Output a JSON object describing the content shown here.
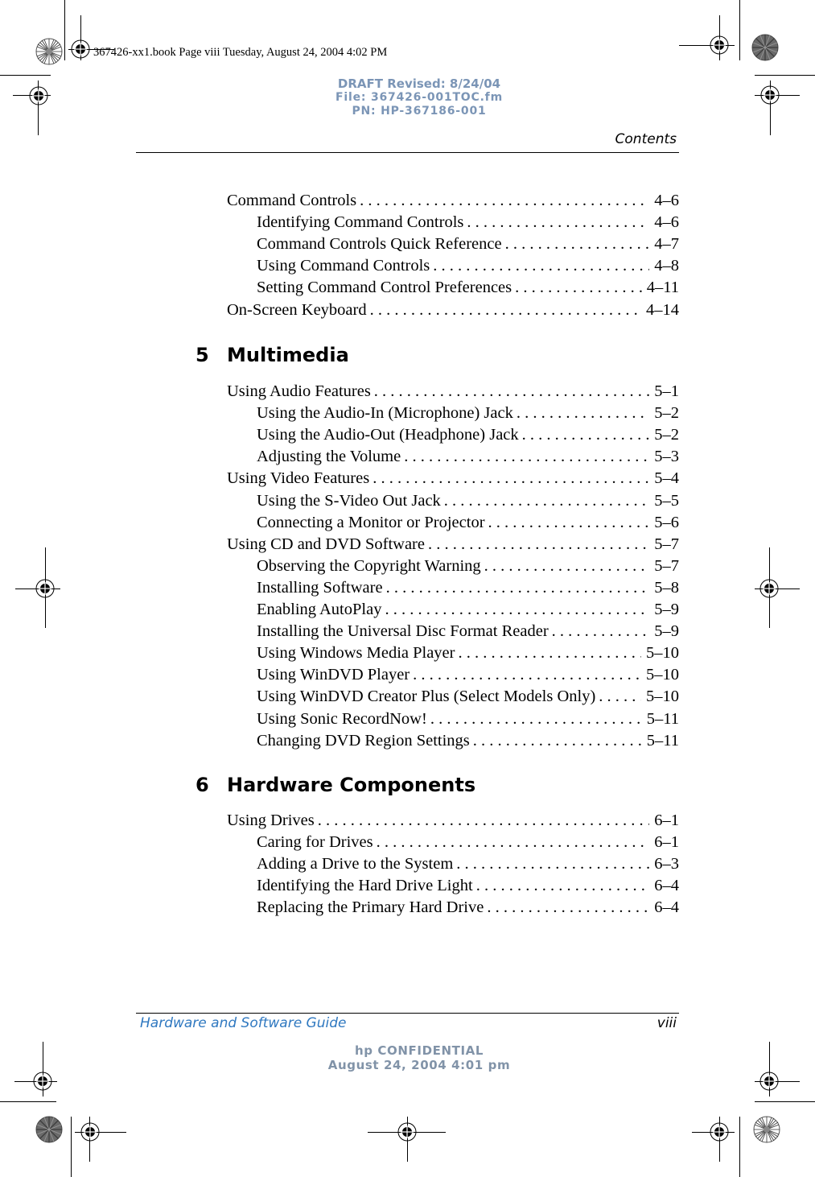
{
  "print_info": {
    "book_line": "367426-xx1.book  Page viii  Tuesday, August 24, 2004  4:02 PM"
  },
  "draft_stamp": {
    "line1": "DRAFT Revised: 8/24/04",
    "line2": "File: 367426-001TOC.fm",
    "line3": "PN: HP-367186-001"
  },
  "header": {
    "running_title": "Contents"
  },
  "toc": {
    "section4_tail": [
      {
        "title": "Command Controls",
        "page": "4–6",
        "level": 1
      },
      {
        "title": "Identifying Command Controls",
        "page": "4–6",
        "level": 2
      },
      {
        "title": "Command Controls Quick Reference",
        "page": "4–7",
        "level": 2
      },
      {
        "title": "Using Command Controls",
        "page": "4–8",
        "level": 2
      },
      {
        "title": "Setting Command Control Preferences",
        "page": "4–11",
        "level": 2
      },
      {
        "title": "On-Screen Keyboard",
        "page": "4–14",
        "level": 1
      }
    ],
    "chapter5": {
      "number": "5",
      "title": "Multimedia",
      "entries": [
        {
          "title": "Using Audio Features",
          "page": "5–1",
          "level": 1
        },
        {
          "title": "Using the Audio-In (Microphone) Jack",
          "page": "5–2",
          "level": 2
        },
        {
          "title": "Using the Audio-Out (Headphone) Jack",
          "page": "5–2",
          "level": 2
        },
        {
          "title": "Adjusting the Volume",
          "page": "5–3",
          "level": 2
        },
        {
          "title": "Using Video Features",
          "page": "5–4",
          "level": 1
        },
        {
          "title": "Using the S-Video Out Jack",
          "page": "5–5",
          "level": 2
        },
        {
          "title": "Connecting a Monitor or Projector",
          "page": "5–6",
          "level": 2
        },
        {
          "title": "Using CD and DVD Software",
          "page": "5–7",
          "level": 1
        },
        {
          "title": "Observing the Copyright Warning",
          "page": "5–7",
          "level": 2
        },
        {
          "title": "Installing Software",
          "page": "5–8",
          "level": 2
        },
        {
          "title": "Enabling AutoPlay",
          "page": "5–9",
          "level": 2
        },
        {
          "title": "Installing the Universal Disc Format Reader",
          "page": "5–9",
          "level": 2
        },
        {
          "title": "Using Windows Media Player",
          "page": "5–10",
          "level": 2
        },
        {
          "title": "Using WinDVD Player",
          "page": "5–10",
          "level": 2
        },
        {
          "title": "Using WinDVD Creator Plus (Select Models Only)",
          "page": "5–10",
          "level": 2
        },
        {
          "title": "Using Sonic RecordNow!",
          "page": "5–11",
          "level": 2
        },
        {
          "title": "Changing DVD Region Settings",
          "page": "5–11",
          "level": 2
        }
      ]
    },
    "chapter6": {
      "number": "6",
      "title": "Hardware Components",
      "entries": [
        {
          "title": "Using Drives",
          "page": "6–1",
          "level": 1
        },
        {
          "title": "Caring for Drives",
          "page": "6–1",
          "level": 2
        },
        {
          "title": "Adding a Drive to the System",
          "page": "6–3",
          "level": 2
        },
        {
          "title": "Identifying the Hard Drive Light",
          "page": "6–4",
          "level": 2
        },
        {
          "title": "Replacing the Primary Hard Drive",
          "page": "6–4",
          "level": 2
        }
      ]
    }
  },
  "footer": {
    "guide_title": "Hardware and Software Guide",
    "page_number": "viii",
    "confidential_line1": "hp CONFIDENTIAL",
    "confidential_line2": "August 24, 2004 4:01 pm"
  },
  "colors": {
    "draft_stamp": "#7b95b6",
    "footer_title": "#2f78c0",
    "confidential": "#8193a8"
  }
}
